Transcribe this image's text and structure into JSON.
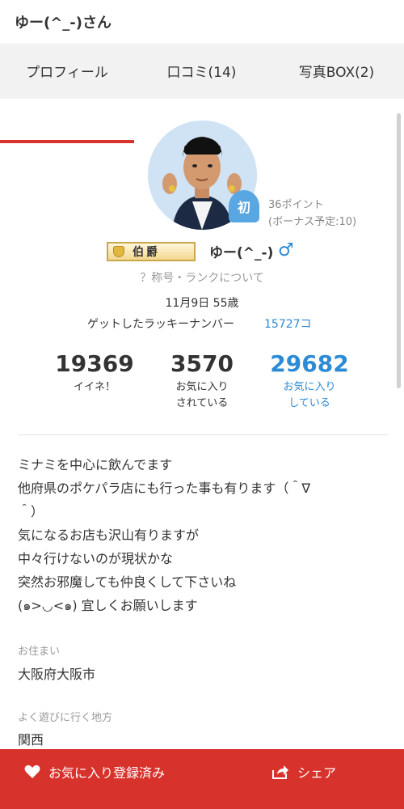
{
  "header": {
    "title": "ゆー(^_-)さん"
  },
  "tabs": [
    {
      "label": "プロフィール",
      "active": true
    },
    {
      "label": "口コミ(14)",
      "active": false
    },
    {
      "label": "写真BOX(2)",
      "active": false
    }
  ],
  "profile": {
    "avatar_icon": "user-avatar",
    "first_time_badge": "初",
    "points": "36ポイント",
    "bonus": "(ボーナス予定:10)",
    "rank_label": "伯爵",
    "username": "ゆー(^_-)",
    "gender_symbol": "♂",
    "rank_help": "？称号・ランクについて",
    "birthday": "11月9日 55歳",
    "lucky_label": "ゲットしたラッキーナンバー",
    "lucky_value": "15727コ"
  },
  "stats": [
    {
      "value": "19369",
      "label_lines": [
        "イイネ！"
      ]
    },
    {
      "value": "3570",
      "label_lines": [
        "お気に入り",
        "されている"
      ]
    },
    {
      "value": "29682",
      "label_lines": [
        "お気に入り",
        "している"
      ]
    }
  ],
  "bio_lines": [
    "ミナミを中心に飲んでます",
    "他府県のポケパラ店にも行った事も有ります（＾∇",
    "＾）",
    "気になるお店も沢山有りますが",
    "中々行けないのが現状かな",
    "突然お邪魔しても仲良くして下さいね",
    "(๑>◡<๑) 宜しくお願いします"
  ],
  "residence": {
    "label": "お住まい",
    "value": "大阪府大阪市"
  },
  "area": {
    "label": "よく遊びに行く地方",
    "value": "関西"
  },
  "bottom_bar": {
    "favorite_label": "お気に入り登録済み",
    "share_label": "シェア"
  },
  "colors": {
    "accent_red": "#d8322c",
    "link_blue": "#2d8bd5",
    "badge_blue": "#59a7e2"
  }
}
